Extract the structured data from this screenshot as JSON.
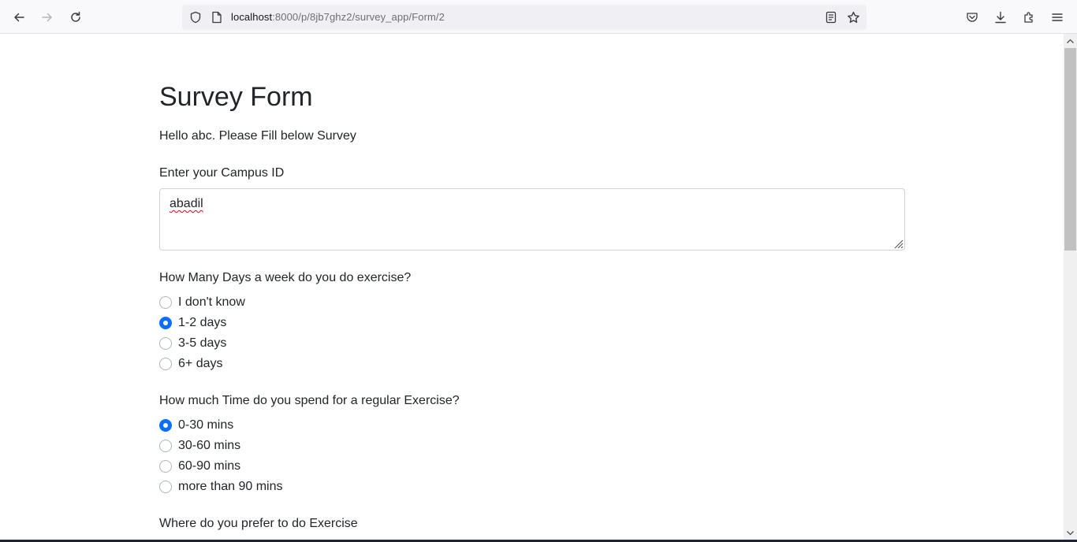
{
  "browser": {
    "url_host": "localhost",
    "url_path": ":8000/p/8jb7ghz2/survey_app/Form/2"
  },
  "page": {
    "title": "Survey Form",
    "greeting": "Hello abc. Please Fill below Survey",
    "campus_id": {
      "label": "Enter your Campus ID",
      "value": "abadil"
    },
    "q_days": {
      "label": "How Many Days a week do you do exercise?",
      "options": [
        "I don't know",
        "1-2 days",
        "3-5 days",
        "6+ days"
      ],
      "selected": "1-2 days"
    },
    "q_time": {
      "label": "How much Time do you spend for a regular Exercise?",
      "options": [
        "0-30 mins",
        "30-60 mins",
        "60-90 mins",
        "more than 90 mins"
      ],
      "selected": "0-30 mins"
    },
    "q_place": {
      "label": "Where do you prefer to do Exercise"
    }
  },
  "colors": {
    "accent": "#0d6efd",
    "text": "#212529",
    "border": "#ced4da"
  }
}
